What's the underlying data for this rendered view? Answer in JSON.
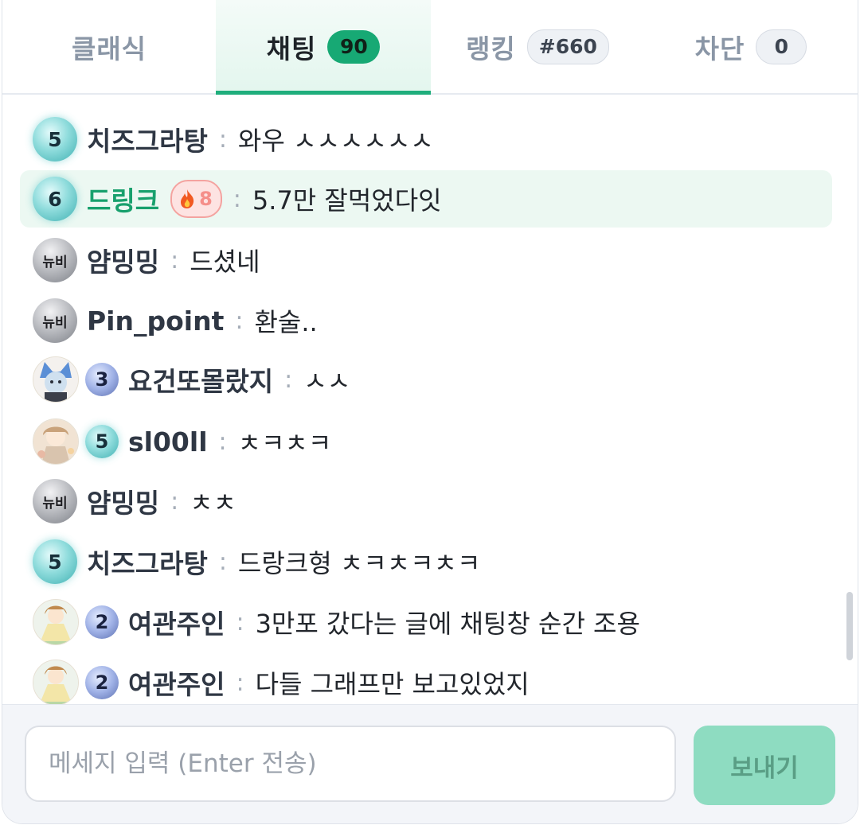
{
  "tabs": [
    {
      "label": "클래식",
      "badge": ""
    },
    {
      "label": "채팅",
      "badge": "90"
    },
    {
      "label": "랭킹",
      "badge": "#660"
    },
    {
      "label": "차단",
      "badge": "0"
    }
  ],
  "messages": [
    {
      "level": "5",
      "name": "치즈그라탕",
      "text": "와우 ㅅㅅㅅㅅㅅㅅ"
    },
    {
      "level": "6",
      "name": "드링크",
      "fire": "8",
      "text": "5.7만 잘먹었다잇"
    },
    {
      "level": "뉴비",
      "name": "얌밍밍",
      "text": "드셨네"
    },
    {
      "level": "뉴비",
      "name": "Pin_point",
      "text": "환술.."
    },
    {
      "level": "3",
      "name": "요건또몰랐지",
      "text": "ㅅㅅ"
    },
    {
      "level": "5",
      "name": "sl00ll",
      "text": "ㅊㅋㅊㅋ"
    },
    {
      "level": "뉴비",
      "name": "얌밍밍",
      "text": "ㅊㅊ"
    },
    {
      "level": "5",
      "name": "치즈그라탕",
      "text": "드랑크형 ㅊㅋㅊㅋㅊㅋ"
    },
    {
      "level": "2",
      "name": "여관주인",
      "text": "3만포 갔다는 글에 채팅창 순간 조용"
    },
    {
      "level": "2",
      "name": "여관주인",
      "text": "다들 그래프만 보고있었지"
    }
  ],
  "separator": ":",
  "input": {
    "placeholder": "메세지 입력 (Enter 전송)",
    "send_label": "보내기"
  },
  "colors": {
    "accent": "#1fae7c",
    "send_button": "#8edcc1",
    "highlight_row": "#ecf8f2"
  }
}
